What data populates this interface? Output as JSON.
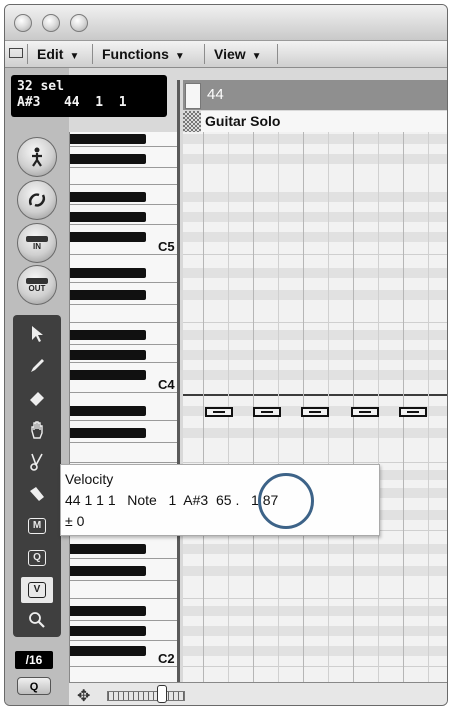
{
  "menubar": {
    "edit": "Edit",
    "functions": "Functions",
    "view": "View"
  },
  "lcd": {
    "line1": "32 sel",
    "line2": "A#3   44  1  1"
  },
  "left_buttons": {
    "in_label": "IN",
    "out_label": "OUT"
  },
  "quantize": {
    "value": "/16",
    "button_label": "Q"
  },
  "ruler": {
    "bar_number": "44"
  },
  "track": {
    "name": "Guitar Solo"
  },
  "keyboard": {
    "octave_labels": [
      "C5",
      "C4",
      "C2"
    ]
  },
  "tooltip": {
    "title": "Velocity",
    "line2": "44 1 1 1   Note   1  A#3  65 .   1 87",
    "line3": "± 0"
  },
  "colors": {
    "highlight_ring": "#3d6388",
    "toolbox_bg": "#3f3f3f",
    "lcd_bg": "#000000"
  },
  "icons": [
    "close-window-icon",
    "minimize-window-icon",
    "zoom-window-icon",
    "hide-list-icon",
    "catch-playhead-icon",
    "link-icon",
    "midi-in-icon",
    "midi-out-icon",
    "pointer-tool-icon",
    "pencil-tool-icon",
    "eraser-tool-icon",
    "hand-tool-icon",
    "scissors-tool-icon",
    "glue-tool-icon",
    "mute-tool-icon",
    "quantize-tool-icon",
    "velocity-tool-icon",
    "zoom-tool-icon",
    "move-icon"
  ]
}
